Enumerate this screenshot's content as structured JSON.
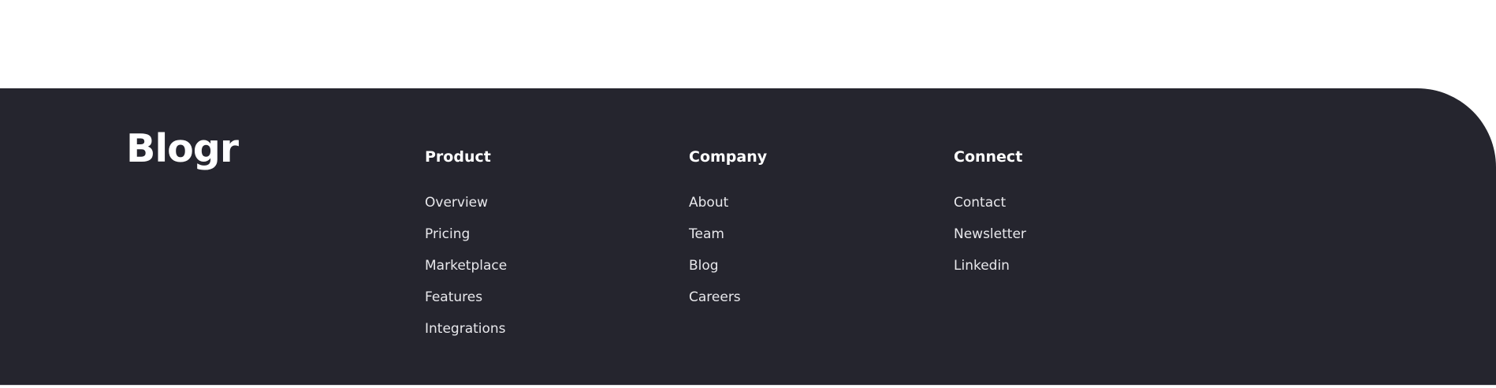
{
  "footer": {
    "logo": "Blogr",
    "colors": {
      "background": "#25252e",
      "text": "#ffffff",
      "page_background": "#ffffff"
    },
    "columns": [
      {
        "title": "Product",
        "links": [
          "Overview",
          "Pricing",
          "Marketplace",
          "Features",
          "Integrations"
        ]
      },
      {
        "title": "Company",
        "links": [
          "About",
          "Team",
          "Blog",
          "Careers"
        ]
      },
      {
        "title": "Connect",
        "links": [
          "Contact",
          "Newsletter",
          "Linkedin"
        ]
      }
    ]
  }
}
